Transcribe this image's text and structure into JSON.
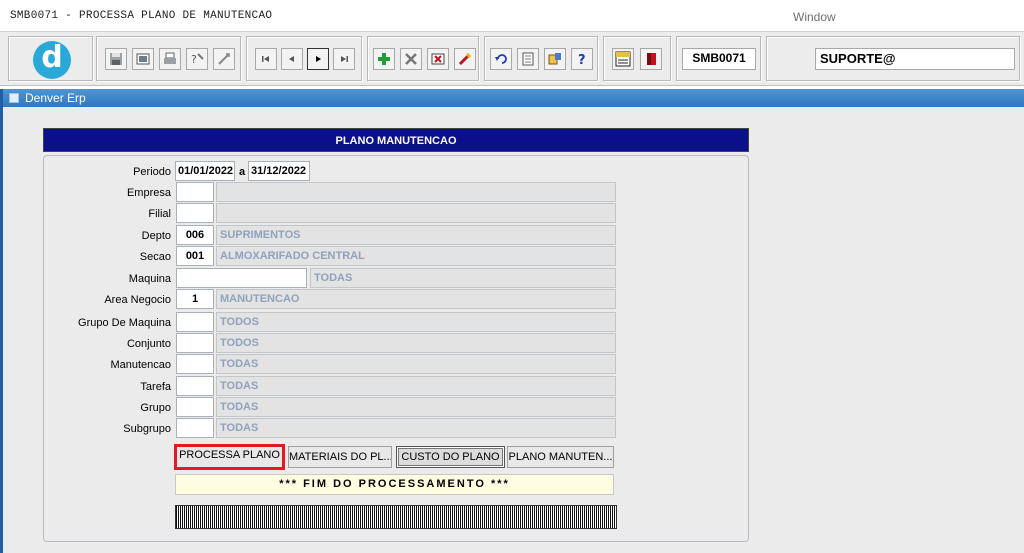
{
  "window": {
    "title": "SMB0071 - PROCESSA PLANO DE MANUTENCAO",
    "menu": "Window"
  },
  "toolbar": {
    "logo_letter": "d",
    "program_code": "SMB0071",
    "user": "SUPORTE@",
    "icons": [
      "save-icon",
      "print-preview-icon",
      "print-icon",
      "query-help-icon",
      "query-run-icon",
      "first-record-icon",
      "previous-record-icon",
      "next-record-icon",
      "last-record-icon",
      "insert-record-icon",
      "delete-record-icon",
      "clear-icon",
      "edit-icon",
      "undo-icon",
      "list-icon",
      "info-icon",
      "help-icon",
      "menu-icon",
      "exit-icon"
    ]
  },
  "app": {
    "name": "Denver Erp"
  },
  "form": {
    "header": "PLANO MANUTENCAO",
    "fields": {
      "periodo": {
        "label": "Periodo",
        "from": "01/01/2022",
        "sep": "a",
        "to": "31/12/2022"
      },
      "empresa": {
        "label": "Empresa",
        "code": "",
        "desc": ""
      },
      "filial": {
        "label": "Filial",
        "code": "",
        "desc": ""
      },
      "depto": {
        "label": "Depto",
        "code": "006",
        "desc": "SUPRIMENTOS"
      },
      "secao": {
        "label": "Secao",
        "code": "001",
        "desc": "ALMOXARIFADO CENTRAL"
      },
      "maquina": {
        "label": "Maquina",
        "code": "",
        "desc": "TODAS"
      },
      "area_negocio": {
        "label": "Area Negocio",
        "code": "1",
        "desc": "MANUTENCAO"
      },
      "grupo_maquina": {
        "label": "Grupo De Maquina",
        "code": "",
        "desc": "TODOS"
      },
      "conjunto": {
        "label": "Conjunto",
        "code": "",
        "desc": "TODOS"
      },
      "manutencao": {
        "label": "Manutencao",
        "code": "",
        "desc": "TODAS"
      },
      "tarefa": {
        "label": "Tarefa",
        "code": "",
        "desc": "TODAS"
      },
      "grupo": {
        "label": "Grupo",
        "code": "",
        "desc": "TODAS"
      },
      "subgrupo": {
        "label": "Subgrupo",
        "code": "",
        "desc": "TODAS"
      }
    },
    "buttons": {
      "processa": "PROCESSA PLANO",
      "materiais": "MATERIAIS DO PL...",
      "custo": "CUSTO DO PLANO",
      "plano": "PLANO MANUTEN..."
    },
    "status": "*** FIM DO PROCESSAMENTO ***"
  },
  "colors": {
    "header_bg": "#0a0f8a",
    "window_bar": "#3a83c8",
    "desc_text": "#8fa2bd",
    "highlight": "#e01b24",
    "status_bg": "#fffde1"
  }
}
